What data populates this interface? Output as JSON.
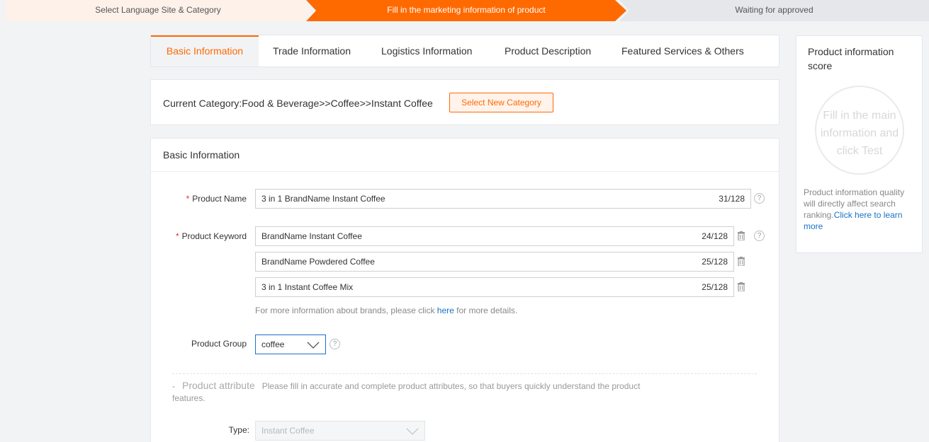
{
  "steps": [
    {
      "label": "Select Language Site & Category"
    },
    {
      "label": "Fill in the marketing information of product"
    },
    {
      "label": "Waiting for approved"
    }
  ],
  "tabs": [
    {
      "label": "Basic Information"
    },
    {
      "label": "Trade Information"
    },
    {
      "label": "Logistics Information"
    },
    {
      "label": "Product Description"
    },
    {
      "label": "Featured Services & Others"
    }
  ],
  "category": {
    "text": "Current Category:Food & Beverage>>Coffee>>Instant Coffee",
    "button_label": "Select New Category"
  },
  "basic_info": {
    "title": "Basic Information",
    "required_mark": "*",
    "product_name": {
      "label": "Product Name",
      "value": "3 in 1 BrandName Instant Coffee",
      "counter": "31/128"
    },
    "keyword": {
      "label": "Product Keyword",
      "items": [
        {
          "value": "BrandName Instant Coffee",
          "counter": "24/128"
        },
        {
          "value": "BrandName Powdered Coffee",
          "counter": "25/128"
        },
        {
          "value": "3 in 1 Instant Coffee Mix",
          "counter": "25/128"
        }
      ]
    },
    "brand_hint": {
      "before": "For more information about brands, please click ",
      "link": "here",
      "after": " for more details."
    },
    "product_group": {
      "label": "Product Group",
      "value": "coffee"
    },
    "help_glyph": "?",
    "attribute": {
      "dash": "-",
      "title": "Product attribute",
      "description": "Please fill in accurate and complete product attributes, so that buyers quickly understand the product features."
    },
    "type": {
      "label": "Type:",
      "value": "Instant Coffee"
    }
  },
  "score_panel": {
    "title": "Product information score",
    "ring_text": "Fill in the main information and click Test",
    "desc_before": "Product information quality will directly affect search ranking.",
    "desc_link": "Click here to learn more"
  },
  "colors": {
    "accent": "#ff6a00",
    "link": "#1a72c6",
    "required": "#e62e2e"
  },
  "icons": [
    "help-icon",
    "trash-icon",
    "chevron-down-icon"
  ]
}
